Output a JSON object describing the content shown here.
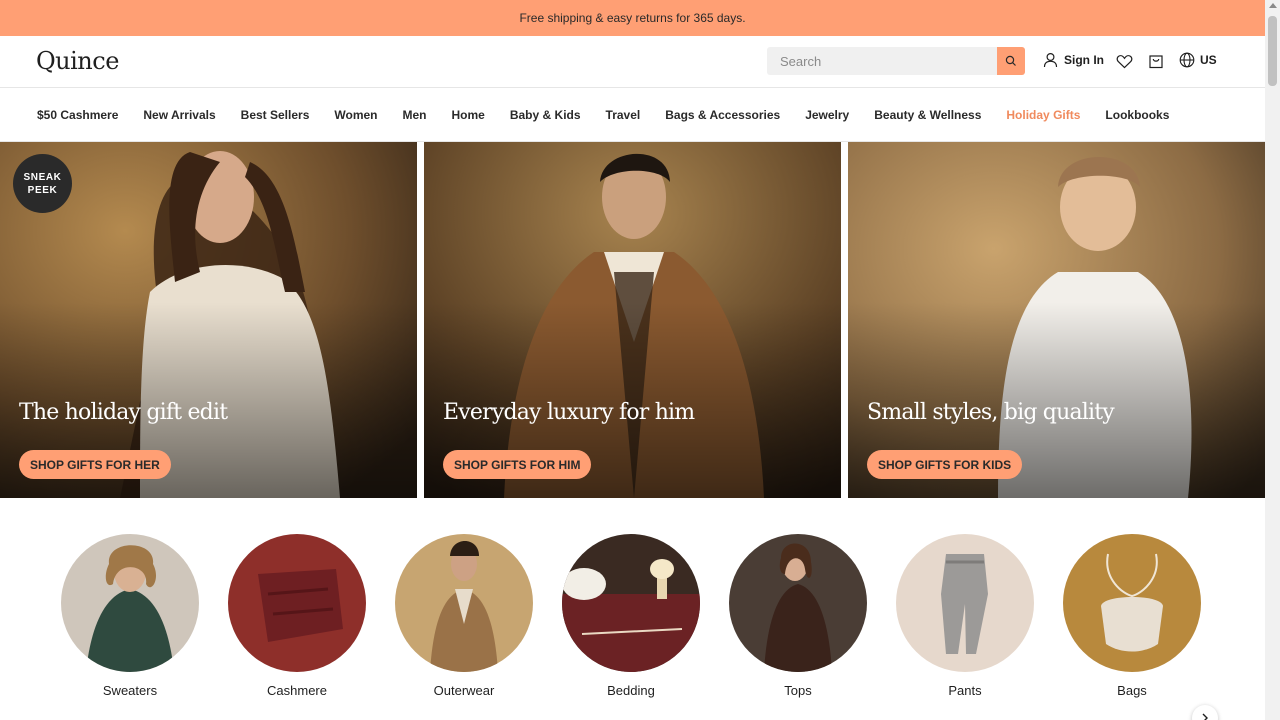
{
  "promo": {
    "text": "Free shipping & easy returns for 365 days."
  },
  "header": {
    "logo": "Quince",
    "search_placeholder": "Search",
    "sign_in": "Sign In",
    "locale": "US",
    "accent_color": "#ff9f74"
  },
  "nav": {
    "items": [
      {
        "label": "$50 Cashmere"
      },
      {
        "label": "New Arrivals"
      },
      {
        "label": "Best Sellers"
      },
      {
        "label": "Women"
      },
      {
        "label": "Men"
      },
      {
        "label": "Home"
      },
      {
        "label": "Baby & Kids"
      },
      {
        "label": "Travel"
      },
      {
        "label": "Bags & Accessories"
      },
      {
        "label": "Jewelry"
      },
      {
        "label": "Beauty & Wellness"
      },
      {
        "label": "Holiday Gifts",
        "highlight_color": "#f08a5d"
      },
      {
        "label": "Lookbooks"
      }
    ]
  },
  "badge": {
    "line1": "SNEAK",
    "line2": "PEEK"
  },
  "heroes": [
    {
      "title": "The holiday gift edit",
      "button": "SHOP GIFTS FOR HER"
    },
    {
      "title": "Everyday luxury for him",
      "button": "SHOP GIFTS FOR HIM"
    },
    {
      "title": "Small styles, big quality",
      "button": "SHOP GIFTS FOR KIDS"
    }
  ],
  "categories": [
    {
      "label": "Sweaters"
    },
    {
      "label": "Cashmere"
    },
    {
      "label": "Outerwear"
    },
    {
      "label": "Bedding"
    },
    {
      "label": "Tops"
    },
    {
      "label": "Pants"
    },
    {
      "label": "Bags"
    }
  ]
}
